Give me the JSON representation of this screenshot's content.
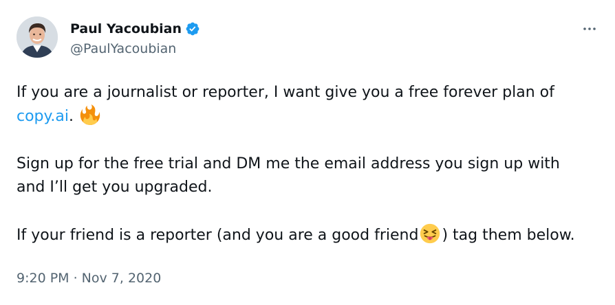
{
  "author": {
    "display_name": "Paul Yacoubian",
    "handle": "@PaulYacoubian",
    "verified": true
  },
  "menu": {
    "icon": "more-icon"
  },
  "tweet": {
    "line1_prefix": "If you are a journalist or reporter, I want give you a free forever plan of",
    "link_text": "copy.ai",
    "line2_suffix": ".",
    "fire_emoji": "fire-emoji",
    "line3": "Sign up for the free trial and DM me the email address you sign up with",
    "line4": "and I’ll get you upgraded.",
    "line5_prefix": "If your friend is a reporter (and you are a good friend",
    "tongue_emoji": "squinting-tongue-emoji",
    "line5_suffix": ") tag them below."
  },
  "timestamp": "9:20 PM · Nov 7, 2020",
  "colors": {
    "text": "#0f1419",
    "secondary": "#536471",
    "link": "#1d9bf0",
    "verified": "#1d9bf0"
  }
}
